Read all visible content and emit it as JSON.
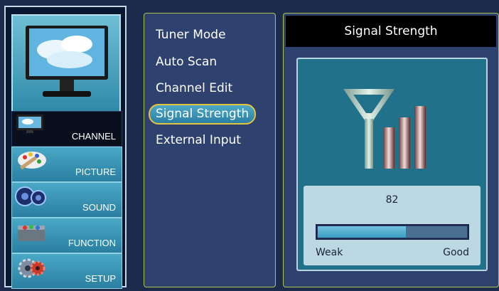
{
  "sidebar": {
    "items": [
      {
        "label": "CHANNEL",
        "icon": "tv-icon",
        "active": true
      },
      {
        "label": "PICTURE",
        "icon": "palette-icon",
        "active": false
      },
      {
        "label": "SOUND",
        "icon": "speaker-icon",
        "active": false
      },
      {
        "label": "FUNCTION",
        "icon": "toolbox-icon",
        "active": false
      },
      {
        "label": "SETUP",
        "icon": "gear-icon",
        "active": false
      }
    ]
  },
  "submenu": {
    "items": [
      {
        "label": "Tuner Mode",
        "selected": false
      },
      {
        "label": "Auto Scan",
        "selected": false
      },
      {
        "label": "Channel Edit",
        "selected": false
      },
      {
        "label": "Signal Strength",
        "selected": true
      },
      {
        "label": "External Input",
        "selected": false
      }
    ]
  },
  "panel": {
    "title": "Signal Strength",
    "meter": {
      "value": "82",
      "level_percent": 59,
      "low_label": "Weak",
      "high_label": "Good"
    }
  },
  "colors": {
    "accent_border": "#aac34e",
    "selection_outline": "#e5c33a",
    "panel_bg": "#2f416e"
  }
}
